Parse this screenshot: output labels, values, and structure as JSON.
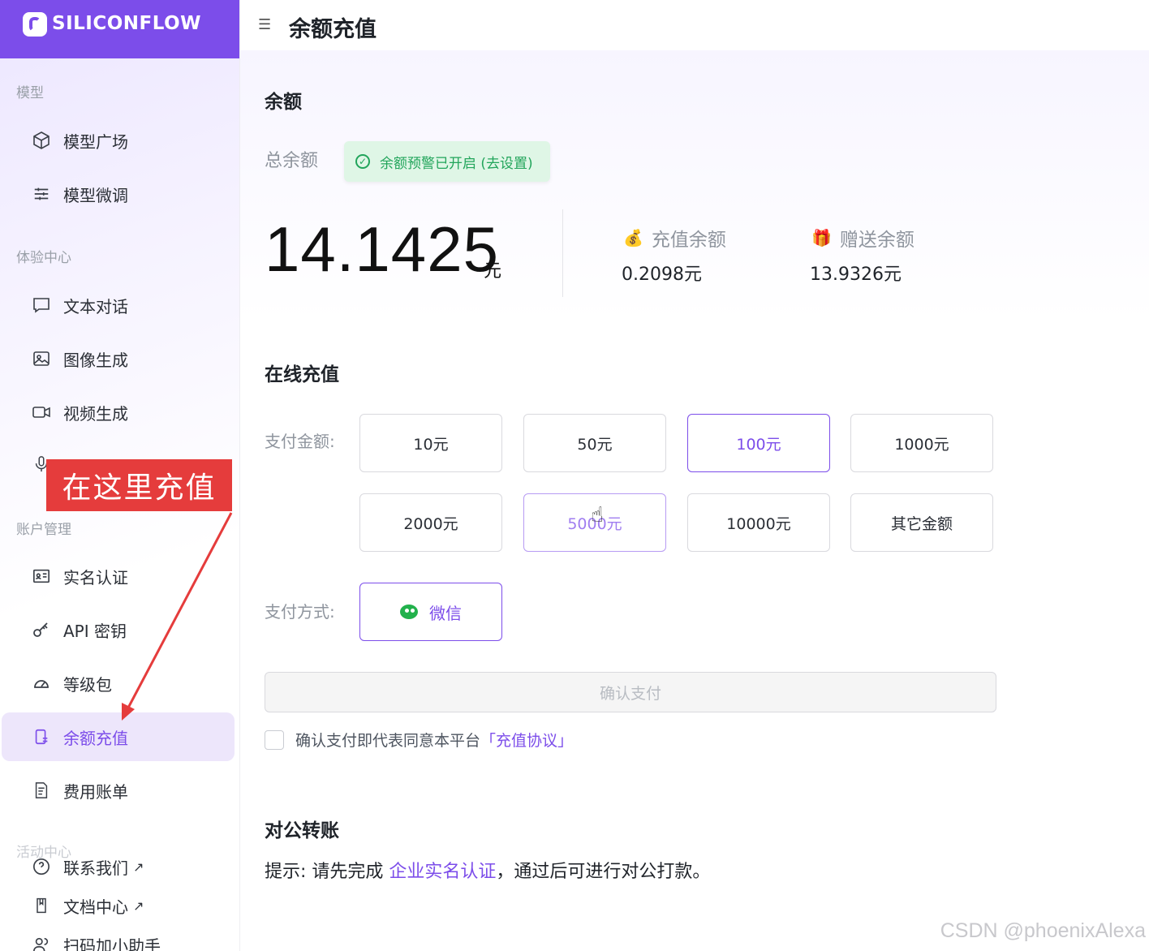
{
  "brand": {
    "name": "SILICONFLOW"
  },
  "header": {
    "title": "余额充值"
  },
  "sidebar": {
    "groups": [
      {
        "label": "模型",
        "items": [
          {
            "label": "模型广场",
            "icon": "cube-icon"
          },
          {
            "label": "模型微调",
            "icon": "sliders-icon"
          }
        ]
      },
      {
        "label": "体验中心",
        "items": [
          {
            "label": "文本对话",
            "icon": "chat-icon"
          },
          {
            "label": "图像生成",
            "icon": "image-icon"
          },
          {
            "label": "视频生成",
            "icon": "video-icon"
          },
          {
            "label": "",
            "icon": "mic-icon"
          }
        ]
      },
      {
        "label": "账户管理",
        "items": [
          {
            "label": "实名认证",
            "icon": "id-card-icon"
          },
          {
            "label": "API 密钥",
            "icon": "key-icon"
          },
          {
            "label": "等级包",
            "icon": "gauge-icon"
          },
          {
            "label": "余额充值",
            "icon": "wallet-icon",
            "active": true
          },
          {
            "label": "费用账单",
            "icon": "bill-icon"
          }
        ]
      },
      {
        "label": "活动中心",
        "items": [
          {
            "label": "联系我们",
            "icon": "help-icon",
            "external": true
          },
          {
            "label": "文档中心",
            "icon": "book-icon",
            "external": true
          },
          {
            "label": "扫码加小助手",
            "icon": "users-icon"
          }
        ]
      }
    ]
  },
  "balance": {
    "section_title": "余额",
    "total_label": "总余额",
    "warning_badge": "余额预警已开启 (去设置)",
    "total_value": "14.1425",
    "unit": "元",
    "recharge_label": "充值余额",
    "recharge_value": "0.2098元",
    "gift_label": "赠送余额",
    "gift_value": "13.9326元"
  },
  "recharge": {
    "section_title": "在线充值",
    "amount_label": "支付金额:",
    "amounts": [
      "10元",
      "50元",
      "100元",
      "1000元",
      "2000元",
      "5000元",
      "10000元",
      "其它金额"
    ],
    "selected_amount": "100元",
    "method_label": "支付方式:",
    "method": "微信",
    "confirm_button": "确认支付",
    "agree_text": "确认支付即代表同意本平台",
    "agreement_link": "「充值协议」"
  },
  "transfer": {
    "section_title": "对公转账",
    "tip_prefix": "提示: 请先完成 ",
    "tip_link": "企业实名认证",
    "tip_suffix": "，通过后可进行对公打款。"
  },
  "annotation": {
    "text": "在这里充值",
    "color": "#e53c3c"
  },
  "watermark": "CSDN @phoenixAlexa",
  "colors": {
    "accent": "#7c4dea",
    "success": "#22a55b",
    "muted": "#8f959e"
  }
}
